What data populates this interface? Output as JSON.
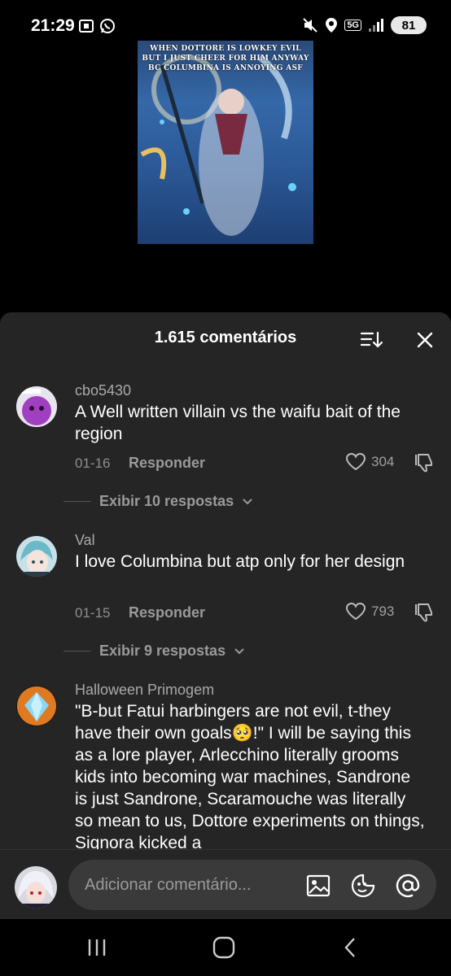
{
  "status_bar": {
    "time": "21:29",
    "network": "5G",
    "battery": "81"
  },
  "video": {
    "caption_lines": [
      "WHEN DOTTORE IS LOWKEY EVIL",
      "BUT I JUST CHEER FOR HIM ANYWAY",
      "BC COLUMBINA IS ANNOYING ASF"
    ]
  },
  "comments_sheet": {
    "title": "1.615 comentários",
    "comments": [
      {
        "username": "cbo5430",
        "text": "A Well written villain vs the waifu bait of the region",
        "date": "01-16",
        "reply_label": "Responder",
        "likes": "304",
        "view_replies": "Exibir 10 respostas"
      },
      {
        "username": "Val",
        "text": "I love Columbina but atp only for her design",
        "date": "01-15",
        "reply_label": "Responder",
        "likes": "793",
        "view_replies": "Exibir 9 respostas"
      },
      {
        "username": "Halloween Primogem",
        "text": "\"B-but Fatui harbingers are not evil, t-they have their own goals🥺!\" I will be saying this as a lore player, Arlecchino literally grooms kids into becoming war machines, Sandrone is just Sandrone, Scaramouche was literally so mean to us, Dottore experiments on things, Signora kicked a"
      }
    ]
  },
  "input_bar": {
    "placeholder": "Adicionar comentário..."
  },
  "colors": {
    "sheet_background": "#252525",
    "input_background": "#3a3a3a",
    "secondary_text": "#9a9a9a"
  }
}
